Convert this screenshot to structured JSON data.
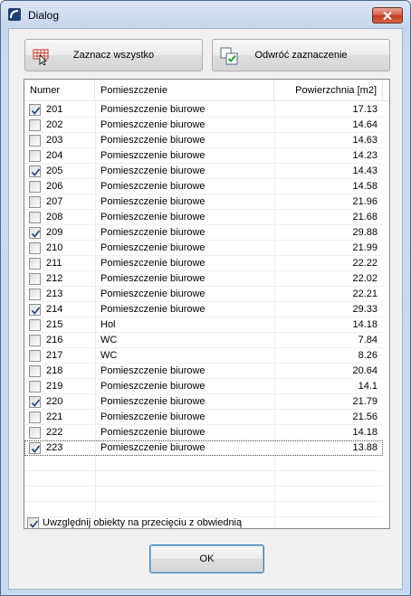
{
  "window": {
    "title": "Dialog"
  },
  "toolbar": {
    "select_all_label": "Zaznacz wszystko",
    "invert_label": "Odwróć zaznaczenie"
  },
  "table": {
    "columns": [
      "Numer",
      "Pomieszczenie",
      "Powierzchnia [m2]"
    ],
    "rows": [
      {
        "checked": true,
        "number": "201",
        "name": "Pomieszczenie biurowe",
        "area": "17.13"
      },
      {
        "checked": false,
        "number": "202",
        "name": "Pomieszczenie biurowe",
        "area": "14.64"
      },
      {
        "checked": false,
        "number": "203",
        "name": "Pomieszczenie biurowe",
        "area": "14.63"
      },
      {
        "checked": false,
        "number": "204",
        "name": "Pomieszczenie biurowe",
        "area": "14.23"
      },
      {
        "checked": true,
        "number": "205",
        "name": "Pomieszczenie biurowe",
        "area": "14.43"
      },
      {
        "checked": false,
        "number": "206",
        "name": "Pomieszczenie biurowe",
        "area": "14.58"
      },
      {
        "checked": false,
        "number": "207",
        "name": "Pomieszczenie biurowe",
        "area": "21.96"
      },
      {
        "checked": false,
        "number": "208",
        "name": "Pomieszczenie biurowe",
        "area": "21.68"
      },
      {
        "checked": true,
        "number": "209",
        "name": "Pomieszczenie biurowe",
        "area": "29.88"
      },
      {
        "checked": false,
        "number": "210",
        "name": "Pomieszczenie biurowe",
        "area": "21.99"
      },
      {
        "checked": false,
        "number": "211",
        "name": "Pomieszczenie biurowe",
        "area": "22.22"
      },
      {
        "checked": false,
        "number": "212",
        "name": "Pomieszczenie biurowe",
        "area": "22.02"
      },
      {
        "checked": false,
        "number": "213",
        "name": "Pomieszczenie biurowe",
        "area": "22.21"
      },
      {
        "checked": true,
        "number": "214",
        "name": "Pomieszczenie biurowe",
        "area": "29.33"
      },
      {
        "checked": false,
        "number": "215",
        "name": "Hol",
        "area": "14.18"
      },
      {
        "checked": false,
        "number": "216",
        "name": "WC",
        "area": "7.84"
      },
      {
        "checked": false,
        "number": "217",
        "name": "WC",
        "area": "8.26"
      },
      {
        "checked": false,
        "number": "218",
        "name": "Pomieszczenie biurowe",
        "area": "20.64"
      },
      {
        "checked": false,
        "number": "219",
        "name": "Pomieszczenie biurowe",
        "area": "14.1"
      },
      {
        "checked": true,
        "number": "220",
        "name": "Pomieszczenie biurowe",
        "area": "21.79"
      },
      {
        "checked": false,
        "number": "221",
        "name": "Pomieszczenie biurowe",
        "area": "21.56"
      },
      {
        "checked": false,
        "number": "222",
        "name": "Pomieszczenie biurowe",
        "area": "14.18"
      },
      {
        "checked": true,
        "number": "223",
        "name": "Pomieszczenie biurowe",
        "area": "13.88"
      }
    ]
  },
  "options": {
    "include_intersecting_label": "Uwzględnij obiekty na przecięciu z obwiednią",
    "include_intersecting_checked": true
  },
  "footer": {
    "ok_label": "OK"
  },
  "icons": {
    "app": "dialog-app-icon",
    "close": "close-icon",
    "select_all": "select-all-grid-icon",
    "invert": "invert-selection-icon",
    "check": "check-icon"
  },
  "colors": {
    "accent": "#3c7fb1",
    "close": "#c1391f",
    "window_frame": "#c5d6ec"
  }
}
